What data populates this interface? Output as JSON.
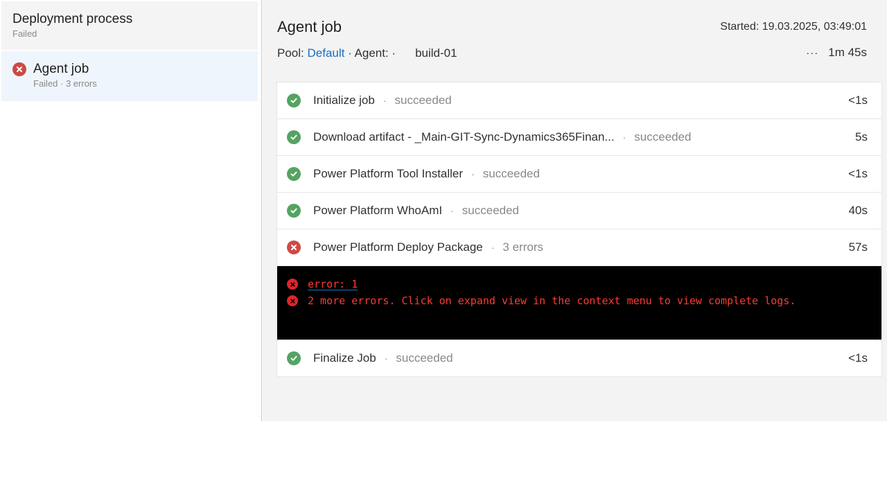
{
  "sidebar": {
    "header": {
      "title": "Deployment process",
      "status": "Failed"
    },
    "items": [
      {
        "title": "Agent job",
        "subtitle": "Failed · 3 errors",
        "state": "error"
      }
    ]
  },
  "job": {
    "title": "Agent job",
    "started": "Started: 19.03.2025, 03:49:01",
    "pool_label": "Pool:",
    "pool_value": "Default",
    "agent_label": "· Agent: ·",
    "agent_value": "build-01",
    "more": "···",
    "duration": "1m 45s"
  },
  "steps": [
    {
      "name": "Initialize job",
      "status": "succeeded",
      "duration": "<1s",
      "state": "ok"
    },
    {
      "name": "Download artifact - _Main-GIT-Sync-Dynamics365Finan...",
      "status": "succeeded",
      "duration": "5s",
      "state": "ok"
    },
    {
      "name": "Power Platform Tool Installer",
      "status": "succeeded",
      "duration": "<1s",
      "state": "ok"
    },
    {
      "name": "Power Platform WhoAmI",
      "status": "succeeded",
      "duration": "40s",
      "state": "ok"
    },
    {
      "name": "Power Platform Deploy Package",
      "status": "3 errors",
      "duration": "57s",
      "state": "error"
    }
  ],
  "console": {
    "lines": [
      {
        "text": "error: 1",
        "link": true
      },
      {
        "text": "2 more errors. Click on expand view in the context menu to view complete logs.",
        "link": false
      }
    ]
  },
  "final_step": {
    "name": "Finalize Job",
    "status": "succeeded",
    "duration": "<1s",
    "state": "ok"
  },
  "colors": {
    "success": "#55a362",
    "error": "#cd4a45",
    "link": "#1b6ec2",
    "console_text": "#ff3b30"
  }
}
